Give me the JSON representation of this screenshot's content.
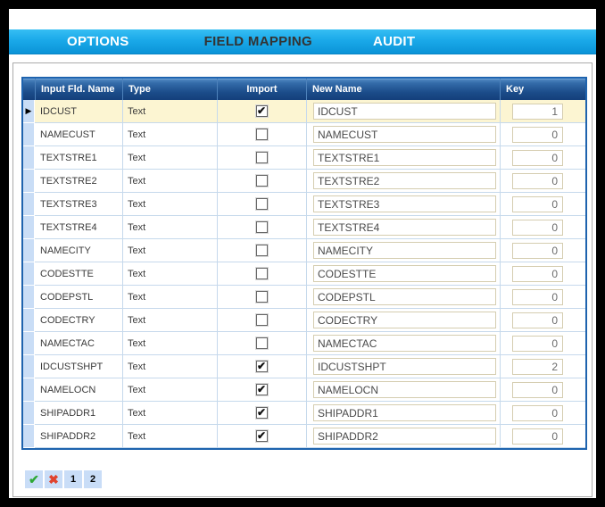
{
  "navbar": {
    "tabs": [
      {
        "label": "OPTIONS",
        "active": false
      },
      {
        "label": "FIELD MAPPING",
        "active": true
      },
      {
        "label": "AUDIT",
        "active": false
      }
    ],
    "bg_top_color": "#36BEF3",
    "bg_bottom_color": "#0B93D7",
    "text_color": "#FFFFFF",
    "active_text_color": "#333333"
  },
  "grid": {
    "columns": [
      "Input Fld. Name",
      "Type",
      "Import",
      "New Name",
      "Key"
    ],
    "header_bg_top": "#558CC4",
    "header_bg_bottom": "#143F7B",
    "border_color": "#1E63AE",
    "active_row_bg": "#FCF5D2",
    "selector_arrow": "▶",
    "rows": [
      {
        "name": "IDCUST",
        "type": "Text",
        "import": true,
        "new_name": "IDCUST",
        "key": "1",
        "active": true
      },
      {
        "name": "NAMECUST",
        "type": "Text",
        "import": false,
        "new_name": "NAMECUST",
        "key": "0",
        "active": false
      },
      {
        "name": "TEXTSTRE1",
        "type": "Text",
        "import": false,
        "new_name": "TEXTSTRE1",
        "key": "0",
        "active": false
      },
      {
        "name": "TEXTSTRE2",
        "type": "Text",
        "import": false,
        "new_name": "TEXTSTRE2",
        "key": "0",
        "active": false
      },
      {
        "name": "TEXTSTRE3",
        "type": "Text",
        "import": false,
        "new_name": "TEXTSTRE3",
        "key": "0",
        "active": false
      },
      {
        "name": "TEXTSTRE4",
        "type": "Text",
        "import": false,
        "new_name": "TEXTSTRE4",
        "key": "0",
        "active": false
      },
      {
        "name": "NAMECITY",
        "type": "Text",
        "import": false,
        "new_name": "NAMECITY",
        "key": "0",
        "active": false
      },
      {
        "name": "CODESTTE",
        "type": "Text",
        "import": false,
        "new_name": "CODESTTE",
        "key": "0",
        "active": false
      },
      {
        "name": "CODEPSTL",
        "type": "Text",
        "import": false,
        "new_name": "CODEPSTL",
        "key": "0",
        "active": false
      },
      {
        "name": "CODECTRY",
        "type": "Text",
        "import": false,
        "new_name": "CODECTRY",
        "key": "0",
        "active": false
      },
      {
        "name": "NAMECTAC",
        "type": "Text",
        "import": false,
        "new_name": "NAMECTAC",
        "key": "0",
        "active": false
      },
      {
        "name": "IDCUSTSHPT",
        "type": "Text",
        "import": true,
        "new_name": "IDCUSTSHPT",
        "key": "2",
        "active": false
      },
      {
        "name": "NAMELOCN",
        "type": "Text",
        "import": true,
        "new_name": "NAMELOCN",
        "key": "0",
        "active": false
      },
      {
        "name": "SHIPADDR1",
        "type": "Text",
        "import": true,
        "new_name": "SHIPADDR1",
        "key": "0",
        "active": false
      },
      {
        "name": "SHIPADDR2",
        "type": "Text",
        "import": true,
        "new_name": "SHIPADDR2",
        "key": "0",
        "active": false
      }
    ]
  },
  "toolbar": {
    "confirm_icon": "✔",
    "cancel_icon": "✖",
    "confirm_color": "#2EA836",
    "cancel_color": "#E0432E",
    "button_bg": "#C9DDF7",
    "page_buttons": [
      "1",
      "2"
    ]
  }
}
